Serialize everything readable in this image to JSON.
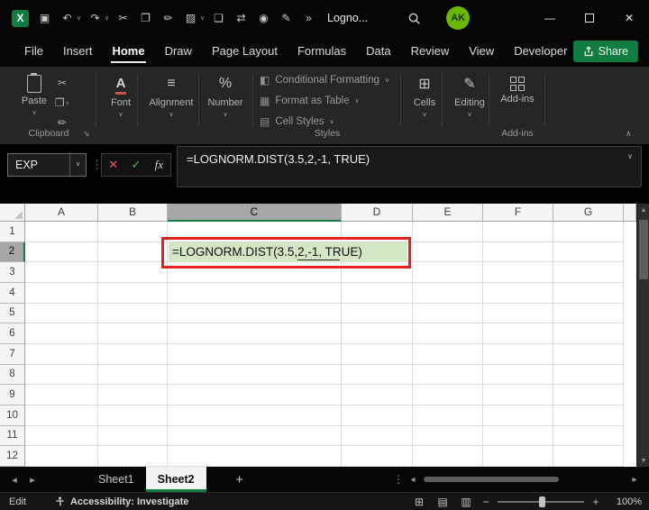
{
  "titlebar": {
    "title": "Logno...",
    "avatar_initials": "AK",
    "qat_icons": [
      {
        "name": "save-icon",
        "glyph": "▣"
      },
      {
        "name": "undo-icon",
        "glyph": "↶",
        "dropdown": true
      },
      {
        "name": "redo-icon",
        "glyph": "↷",
        "dropdown": true
      },
      {
        "name": "cut-icon",
        "glyph": "✂"
      },
      {
        "name": "copy-icon",
        "glyph": "❐"
      },
      {
        "name": "format-painter-icon",
        "glyph": "✏"
      },
      {
        "name": "fill-color-icon",
        "glyph": "▨",
        "dropdown": true
      },
      {
        "name": "new-document-icon",
        "glyph": "❏"
      },
      {
        "name": "switch-windows-icon",
        "glyph": "⇄"
      },
      {
        "name": "camera-icon",
        "glyph": "◉"
      },
      {
        "name": "document-edit-icon",
        "glyph": "✎"
      },
      {
        "name": "more-commands-icon",
        "glyph": "»"
      }
    ]
  },
  "menubar": {
    "items": [
      "File",
      "Insert",
      "Home",
      "Draw",
      "Page Layout",
      "Formulas",
      "Data",
      "Review",
      "View",
      "Developer",
      "Help"
    ],
    "active": "Home",
    "share_label": "Share"
  },
  "ribbon": {
    "paste_label": "Paste",
    "clipboard_caption": "Clipboard",
    "font_label": "Font",
    "alignment_label": "Alignment",
    "number_label": "Number",
    "styles_items": [
      "Conditional Formatting",
      "Format as Table",
      "Cell Styles"
    ],
    "styles_caption": "Styles",
    "cells_label": "Cells",
    "editing_label": "Editing",
    "addins_label": "Add-ins",
    "addins_caption": "Add-ins"
  },
  "formula_bar": {
    "name_box": "EXP",
    "formula": "=LOGNORM.DIST(3.5,2,-1, TRUE)"
  },
  "grid": {
    "columns": [
      "A",
      "B",
      "C",
      "D",
      "E",
      "F",
      "G"
    ],
    "rows": [
      "1",
      "2",
      "3",
      "4",
      "5",
      "6",
      "7",
      "8",
      "9",
      "10",
      "11",
      "12"
    ],
    "selected_column": "C",
    "selected_row": "2",
    "active_cell": {
      "ref": "C2",
      "value": "=LOGNORM.DIST(3.5,2,-1, TRUE)"
    }
  },
  "sheet_tabs": {
    "tabs": [
      {
        "name": "Sheet1",
        "active": false
      },
      {
        "name": "Sheet2",
        "active": true
      }
    ],
    "add_label": "+"
  },
  "status_bar": {
    "mode": "Edit",
    "accessibility_label": "Accessibility: Investigate",
    "zoom_level": "100%"
  },
  "colors": {
    "brand_green": "#107C41",
    "cell_highlight": "#D4E7C5",
    "annotation_red": "#E8211D",
    "selected_header_gray": "#A6A6A6"
  }
}
